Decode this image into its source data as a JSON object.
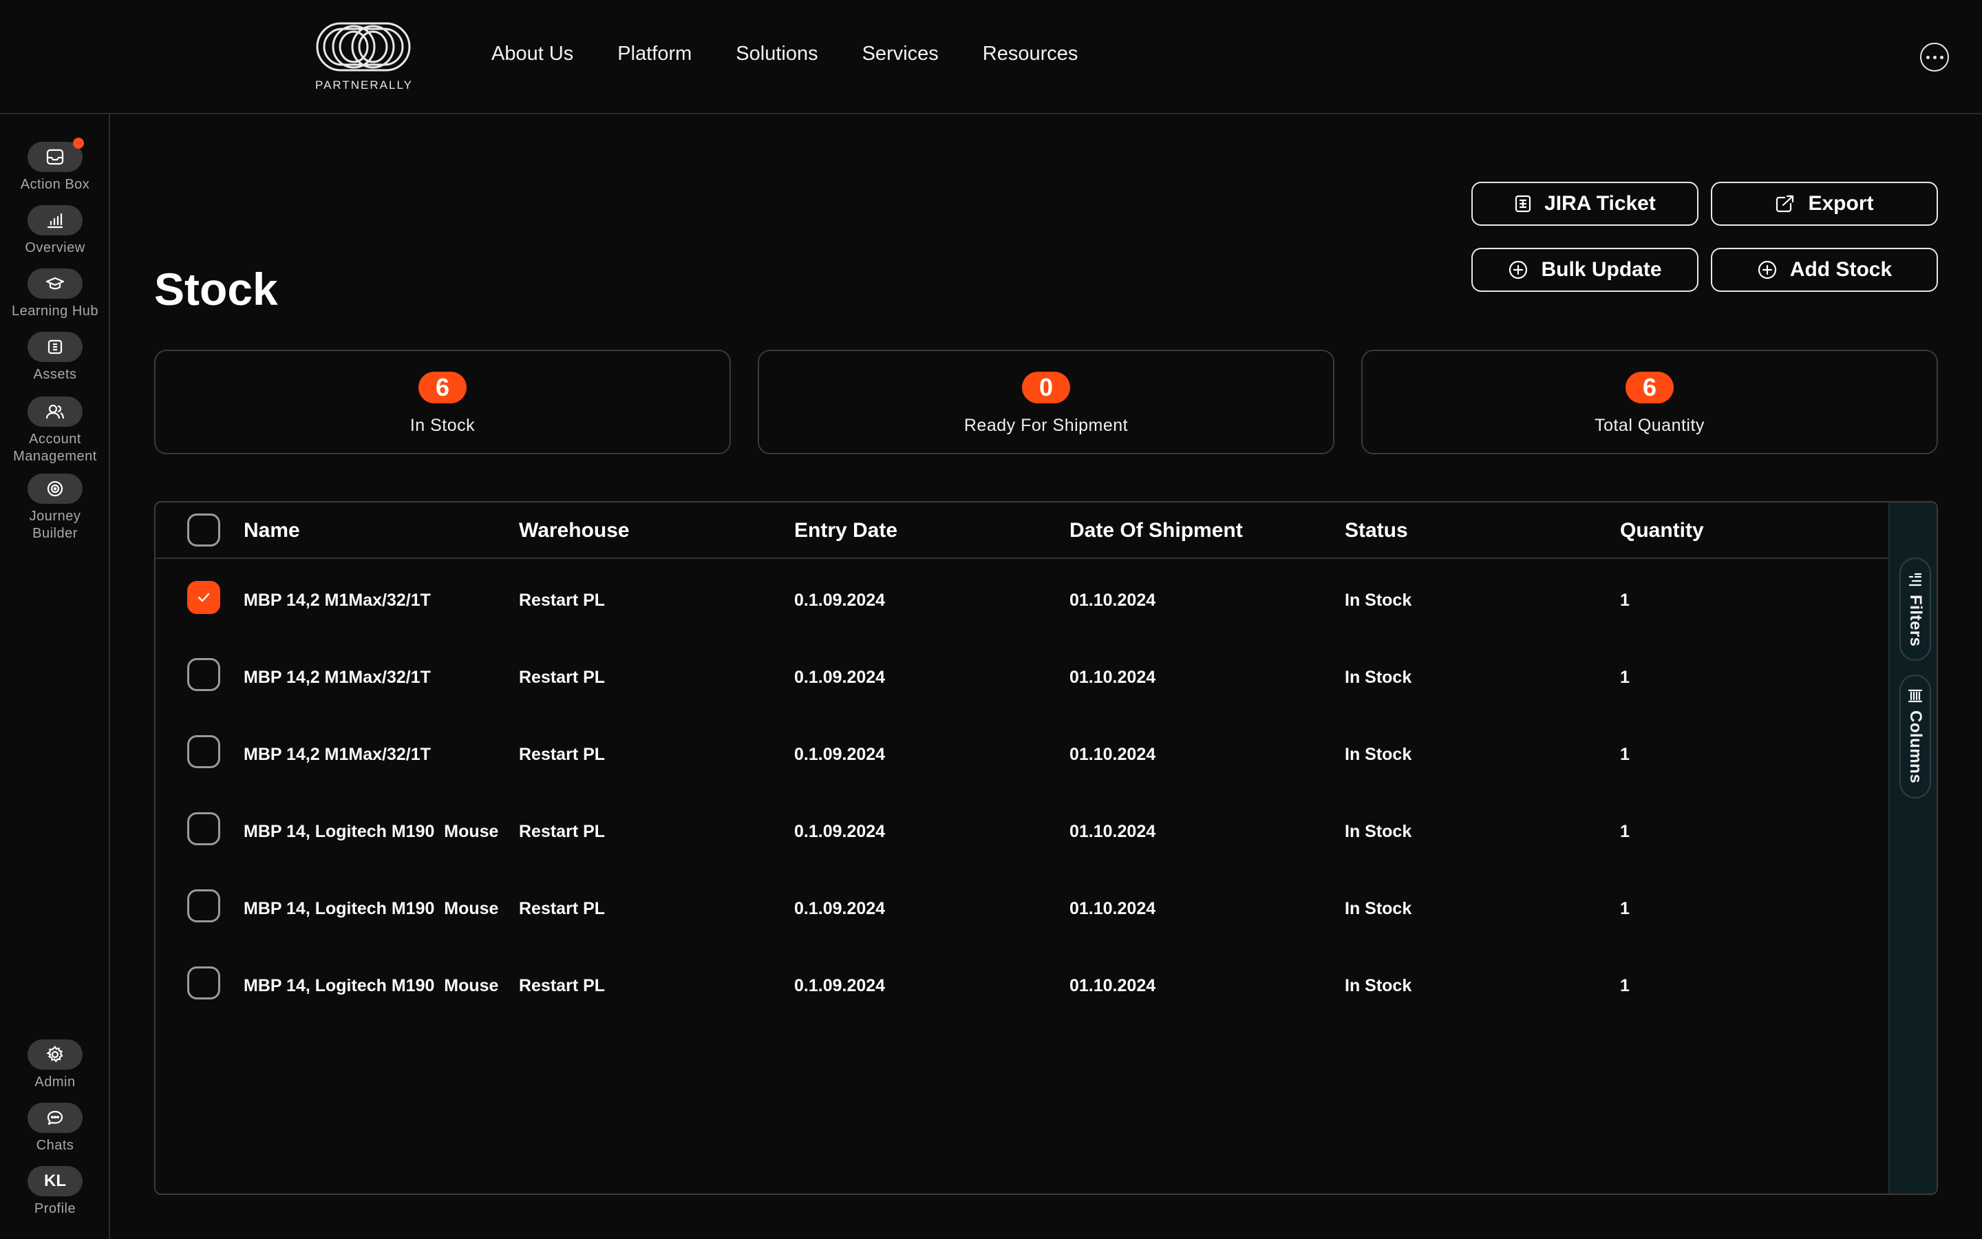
{
  "brand": {
    "name": "PARTNERALLY"
  },
  "nav": {
    "items": [
      {
        "label": "About Us"
      },
      {
        "label": "Platform"
      },
      {
        "label": "Solutions"
      },
      {
        "label": "Services"
      },
      {
        "label": "Resources"
      }
    ]
  },
  "sidebar": {
    "items": [
      {
        "label": "Action Box",
        "icon": "inbox-icon",
        "has_notification": true
      },
      {
        "label": "Overview",
        "icon": "bar-chart-icon"
      },
      {
        "label": "Learning Hub",
        "icon": "graduation-cap-icon"
      },
      {
        "label": "Assets",
        "icon": "grid-icon"
      },
      {
        "label": "Account\nManagement",
        "icon": "users-icon"
      },
      {
        "label": "Journey\nBuilder",
        "icon": "target-icon"
      }
    ],
    "bottom": [
      {
        "label": "Admin",
        "icon": "gear-icon"
      },
      {
        "label": "Chats",
        "icon": "chat-icon"
      },
      {
        "label": "Profile",
        "initials": "KL"
      }
    ]
  },
  "page": {
    "title": "Stock"
  },
  "actions": {
    "jira": "JIRA Ticket",
    "export": "Export",
    "bulk_update": "Bulk Update",
    "add_stock": "Add Stock"
  },
  "stats": [
    {
      "value": "6",
      "label": "In Stock"
    },
    {
      "value": "0",
      "label": "Ready For Shipment"
    },
    {
      "value": "6",
      "label": "Total Quantity"
    }
  ],
  "table": {
    "columns": [
      "Name",
      "Warehouse",
      "Entry Date",
      "Date Of Shipment",
      "Status",
      "Quantity"
    ],
    "rows": [
      {
        "checked": true,
        "name": "MBP 14,2 M1Max/32/1T",
        "warehouse": "Restart PL",
        "entry_date": "0.1.09.2024",
        "shipment_date": "01.10.2024",
        "status": "In Stock",
        "quantity": "1"
      },
      {
        "checked": false,
        "name": "MBP 14,2 M1Max/32/1T",
        "warehouse": "Restart PL",
        "entry_date": "0.1.09.2024",
        "shipment_date": "01.10.2024",
        "status": "In Stock",
        "quantity": "1"
      },
      {
        "checked": false,
        "name": "MBP 14,2 M1Max/32/1T",
        "warehouse": "Restart PL",
        "entry_date": "0.1.09.2024",
        "shipment_date": "01.10.2024",
        "status": "In Stock",
        "quantity": "1"
      },
      {
        "checked": false,
        "name": "MBP 14, Logitech M190  Mouse",
        "warehouse": "Restart PL",
        "entry_date": "0.1.09.2024",
        "shipment_date": "01.10.2024",
        "status": "In Stock",
        "quantity": "1"
      },
      {
        "checked": false,
        "name": "MBP 14, Logitech M190  Mouse",
        "warehouse": "Restart PL",
        "entry_date": "0.1.09.2024",
        "shipment_date": "01.10.2024",
        "status": "In Stock",
        "quantity": "1"
      },
      {
        "checked": false,
        "name": "MBP 14, Logitech M190  Mouse",
        "warehouse": "Restart PL",
        "entry_date": "0.1.09.2024",
        "shipment_date": "01.10.2024",
        "status": "In Stock",
        "quantity": "1"
      }
    ]
  },
  "side_panel": {
    "filters": "Filters",
    "columns": "Columns"
  },
  "colors": {
    "accent": "#ff4a12",
    "background": "#0b0b0b",
    "panel": "#0e1f24"
  }
}
